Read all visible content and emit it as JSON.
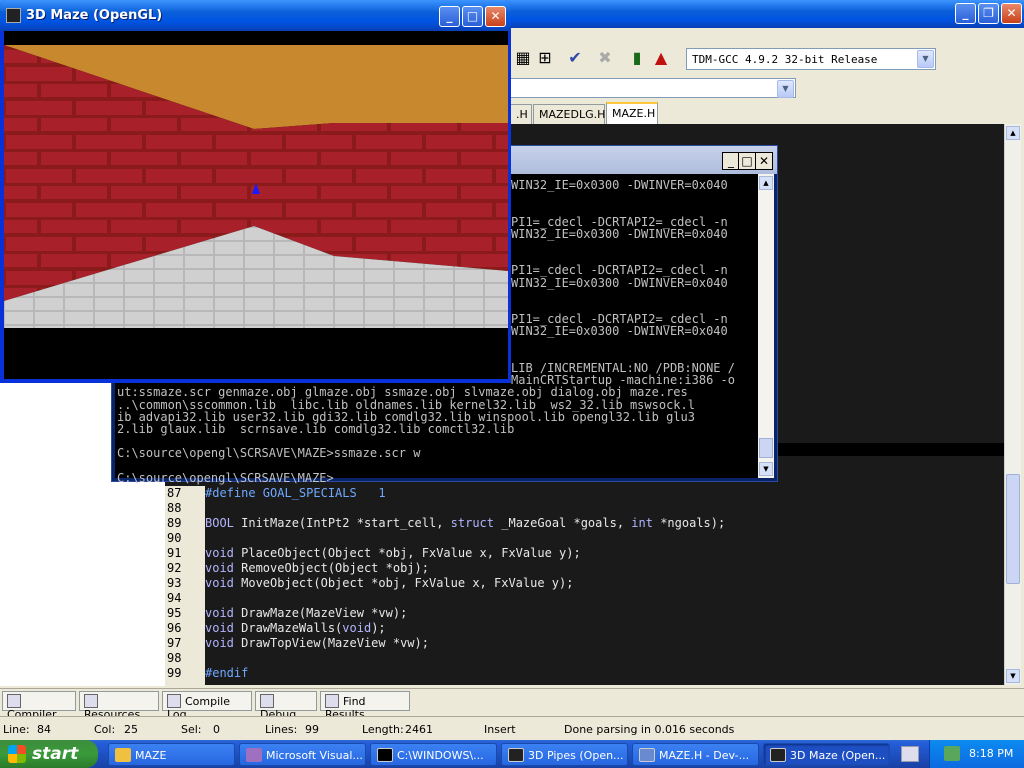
{
  "ide": {
    "compiler": "TDM-GCC 4.9.2 32-bit Release",
    "tabs": [
      ".H",
      "MAZEDLG.H",
      "MAZE.H"
    ],
    "code_lines": [
      {
        "num": "87",
        "parts": [
          [
            "pp",
            "#define GOAL_SPECIALS   1"
          ]
        ]
      },
      {
        "num": "88",
        "parts": []
      },
      {
        "num": "89",
        "parts": [
          [
            "kw",
            "BOOL"
          ],
          [
            "ty",
            " InitMaze(IntPt2 *start_cell, "
          ],
          [
            "kw",
            "struct"
          ],
          [
            "ty",
            " _MazeGoal *goals, "
          ],
          [
            "kw",
            "int"
          ],
          [
            "ty",
            " *ngoals);"
          ]
        ]
      },
      {
        "num": "90",
        "parts": []
      },
      {
        "num": "91",
        "parts": [
          [
            "kw",
            "void"
          ],
          [
            "ty",
            " PlaceObject(Object *obj, FxValue x, FxValue y);"
          ]
        ]
      },
      {
        "num": "92",
        "parts": [
          [
            "kw",
            "void"
          ],
          [
            "ty",
            " RemoveObject(Object *obj);"
          ]
        ]
      },
      {
        "num": "93",
        "parts": [
          [
            "kw",
            "void"
          ],
          [
            "ty",
            " MoveObject(Object *obj, FxValue x, FxValue y);"
          ]
        ]
      },
      {
        "num": "94",
        "parts": []
      },
      {
        "num": "95",
        "parts": [
          [
            "kw",
            "void"
          ],
          [
            "ty",
            " DrawMaze(MazeView *vw);"
          ]
        ]
      },
      {
        "num": "96",
        "parts": [
          [
            "kw",
            "void"
          ],
          [
            "ty",
            " DrawMazeWalls("
          ],
          [
            "kw",
            "void"
          ],
          [
            "ty",
            ");"
          ]
        ]
      },
      {
        "num": "97",
        "parts": [
          [
            "kw",
            "void"
          ],
          [
            "ty",
            " DrawTopView(MazeView *vw);"
          ]
        ]
      },
      {
        "num": "98",
        "parts": []
      },
      {
        "num": "99",
        "parts": [
          [
            "pp",
            "#endif"
          ]
        ]
      }
    ],
    "bottom_tabs": [
      "Compiler",
      "Resources",
      "Compile Log",
      "Debug",
      "Find Results"
    ],
    "status": {
      "line_label": "Line:",
      "line": "84",
      "col_label": "Col:",
      "col": "25",
      "sel_label": "Sel:",
      "sel": "0",
      "lines_label": "Lines:",
      "lines": "99",
      "length_label": "Length:",
      "length": "2461",
      "mode": "Insert",
      "message": "Done parsing in 0.016 seconds"
    }
  },
  "console": {
    "lines": [
      "WIN32_IE=0x0300 -DWINVER=0x040",
      "",
      "",
      "PI1=_cdecl -DCRTAPI2=_cdecl -n",
      "WIN32_IE=0x0300 -DWINVER=0x040",
      "",
      "",
      "PI1=_cdecl -DCRTAPI2=_cdecl -n",
      "WIN32_IE=0x0300 -DWINVER=0x040",
      "",
      "",
      "PI1=_cdecl -DCRTAPI2=_cdecl -n",
      "WIN32_IE=0x0300 -DWINVER=0x040",
      "",
      "",
      "LIB /INCREMENTAL:NO /PDB:NONE /",
      "MainCRTStartup -machine:i386 -o",
      "ut:ssmaze.scr genmaze.obj glmaze.obj ssmaze.obj slvmaze.obj dialog.obj maze.res",
      "..\\common\\sscommon.lib  libc.lib oldnames.lib kernel32.lib  ws2_32.lib mswsock.l",
      "ib advapi32.lib user32.lib gdi32.lib comdlg32.lib winspool.lib opengl32.lib glu3",
      "2.lib glaux.lib  scrnsave.lib comdlg32.lib comctl32.lib",
      "",
      "C:\\source\\opengl\\SCRSAVE\\MAZE>ssmaze.scr w",
      "",
      "C:\\source\\opengl\\SCRSAVE\\MAZE>"
    ]
  },
  "maze": {
    "title": "3D Maze (OpenGL)"
  },
  "taskbar": {
    "start": "start",
    "buttons": [
      "MAZE",
      "Microsoft Visual...",
      "C:\\WINDOWS\\...",
      "3D Pipes (Open...",
      "MAZE.H - Dev-...",
      "3D Maze (Open..."
    ],
    "time": "8:18 PM"
  },
  "colors": {
    "xp_blue": "#0054e3",
    "editor_bg": "#1a1a1a",
    "brick": "#8b1a1a",
    "ceiling": "#c8882e"
  }
}
